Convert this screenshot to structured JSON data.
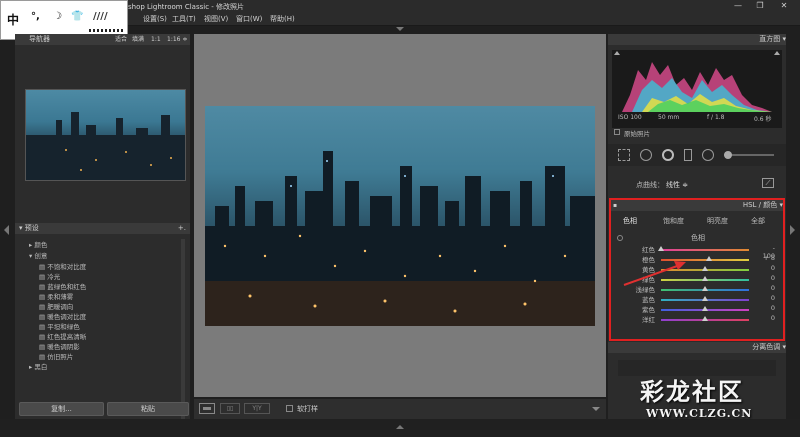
{
  "window": {
    "title": "shop Lightroom Classic - 修改照片",
    "buttons": [
      "—",
      "❐",
      "✕"
    ]
  },
  "ime": {
    "chars": [
      "中",
      "°,",
      "☽",
      "👕",
      "////"
    ]
  },
  "menu": {
    "items": [
      "设置(S)",
      "工具(T)",
      "视图(V)",
      "窗口(W)",
      "帮助(H)"
    ]
  },
  "navigator": {
    "title": "导航器",
    "zoom_options": [
      "适合",
      "填满",
      "1:1",
      "1:16 ≑"
    ]
  },
  "presets": {
    "title": "预设",
    "add": "+.",
    "groups": [
      {
        "label": "颜色",
        "expanded": false
      },
      {
        "label": "创意",
        "expanded": true,
        "items": [
          "不饱和对比度",
          "冷光",
          "蓝绿色和红色",
          "柔和薄雾",
          "肥暖调向",
          "暖色调对比度",
          "平坦和绿色",
          "红色提高清晰",
          "暖色调阴影",
          "仿旧照片"
        ]
      },
      {
        "label": "黑白",
        "expanded": false
      }
    ]
  },
  "left_buttons": {
    "copy": "复制...",
    "paste": "粘贴"
  },
  "toolbar": {
    "soft_proof": "软打样"
  },
  "histogram": {
    "title": "直方图",
    "iso": "ISO 100",
    "focal": "50 mm",
    "aperture": "f / 1.8",
    "shutter": "0.6 秒",
    "original": "原始照片"
  },
  "tone_curve": {
    "label": "点曲线：",
    "value": "线性 ≑"
  },
  "hsl": {
    "title": "HSL / 颜色",
    "tabs": [
      "色相",
      "饱和度",
      "明亮度",
      "全部"
    ],
    "section": "色相",
    "rows": [
      {
        "label": "红色",
        "value": "- 100",
        "level": -100,
        "colors": [
          "#e0409a",
          "#e08a30"
        ]
      },
      {
        "label": "橙色",
        "value": "+ 8",
        "level": 8,
        "colors": [
          "#e05030",
          "#e0d040"
        ]
      },
      {
        "label": "黄色",
        "value": "0",
        "level": 0,
        "colors": [
          "#e08a30",
          "#80d040"
        ]
      },
      {
        "label": "绿色",
        "value": "0",
        "level": 0,
        "colors": [
          "#d0d040",
          "#30c0a0"
        ]
      },
      {
        "label": "浅绿色",
        "value": "0",
        "level": 0,
        "colors": [
          "#40c070",
          "#3070e0"
        ]
      },
      {
        "label": "蓝色",
        "value": "0",
        "level": 0,
        "colors": [
          "#30b0c0",
          "#8040d0"
        ]
      },
      {
        "label": "紫色",
        "value": "0",
        "level": 0,
        "colors": [
          "#4060e0",
          "#d040c0"
        ]
      },
      {
        "label": "洋红",
        "value": "0",
        "level": 0,
        "colors": [
          "#9040d0",
          "#e04060"
        ]
      }
    ]
  },
  "split_toning": {
    "title": "分离色调"
  },
  "watermark": {
    "cn": "彩龙社区",
    "url": "WWW.CLZG.CN"
  },
  "colors": {
    "highlight": "#e02020",
    "arrow": "#e03030"
  }
}
